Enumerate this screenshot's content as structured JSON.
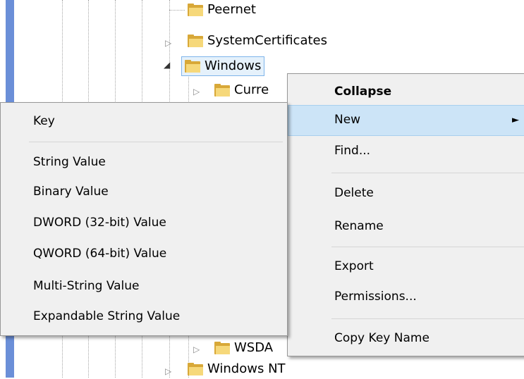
{
  "tree": {
    "peernet": "Peernet",
    "system_certificates": "SystemCertificates",
    "windows": "Windows",
    "current_version": "Curre",
    "wsda": "WSDA",
    "windows_nt": "Windows NT"
  },
  "context_menu": {
    "collapse": "Collapse",
    "new": "New",
    "find": "Find...",
    "delete": "Delete",
    "rename": "Rename",
    "export": "Export",
    "permissions": "Permissions...",
    "copy_key_name": "Copy Key Name",
    "submenu_arrow": "►"
  },
  "new_submenu": {
    "key": "Key",
    "string_value": "String Value",
    "binary_value": "Binary Value",
    "dword_value": "DWORD (32-bit) Value",
    "qword_value": "QWORD (64-bit) Value",
    "multi_string_value": "Multi-String Value",
    "expandable_string_value": "Expandable String Value"
  },
  "icons": {
    "collapsed_expander": "▷",
    "expanded_expander": "◢",
    "folder": "folder-icon"
  },
  "colors": {
    "selection_border": "#7eb4ea",
    "selection_fill": "#e5f1fb",
    "menu_background": "#f0f0f0",
    "menu_highlight": "#cce4f7",
    "left_strip": "#6b8fd8",
    "folder": "#d8a838"
  }
}
